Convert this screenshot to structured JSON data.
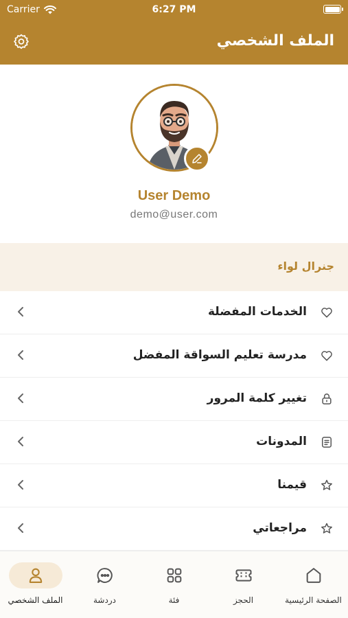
{
  "status_bar": {
    "carrier": "Carrier",
    "time": "6:27 PM"
  },
  "header": {
    "title": "الملف الشخصي",
    "settings_icon": "gear-icon"
  },
  "profile": {
    "name": "User Demo",
    "email": "demo@user.com"
  },
  "section": {
    "label": "جنرال لواء"
  },
  "menu": [
    {
      "label": "الخدمات المفضلة",
      "icon": "heart-icon"
    },
    {
      "label": "مدرسة تعليم السواقة المفضل",
      "icon": "heart-icon"
    },
    {
      "label": "تغيير كلمة المرور",
      "icon": "lock-icon"
    },
    {
      "label": "المدونات",
      "icon": "document-icon"
    },
    {
      "label": "قيمنا",
      "icon": "star-icon"
    },
    {
      "label": "مراجعاتي",
      "icon": "star-icon"
    }
  ],
  "tabs": [
    {
      "label": "الصفحة الرئيسية",
      "icon": "home-icon"
    },
    {
      "label": "الحجز",
      "icon": "ticket-icon"
    },
    {
      "label": "فئة",
      "icon": "grid-icon"
    },
    {
      "label": "دردشة",
      "icon": "chat-icon"
    },
    {
      "label": "الملف الشخصي",
      "icon": "user-icon",
      "active": true
    }
  ],
  "colors": {
    "brand": "#b5842f",
    "section_bg": "#f8f1e7",
    "active_tab_bg": "#f6ead7"
  }
}
